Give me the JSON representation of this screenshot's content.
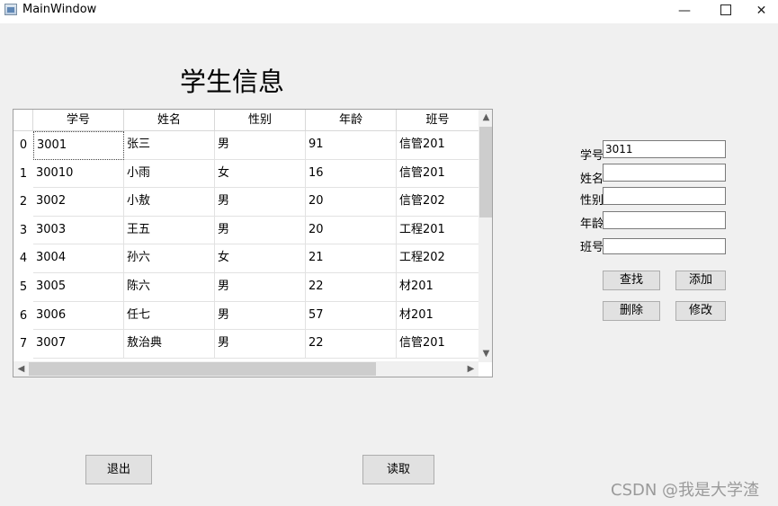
{
  "window": {
    "title": "MainWindow",
    "minimize_glyph": "—",
    "close_glyph": "✕"
  },
  "page_title": "学生信息",
  "table": {
    "columns": [
      "学号",
      "姓名",
      "性别",
      "年龄",
      "班号"
    ],
    "rows": [
      {
        "index": "0",
        "cells": [
          "3001",
          "张三",
          "男",
          "91",
          "信管201"
        ]
      },
      {
        "index": "1",
        "cells": [
          "30010",
          "小雨",
          "女",
          "16",
          "信管201"
        ]
      },
      {
        "index": "2",
        "cells": [
          "3002",
          "小敖",
          "男",
          "20",
          "信管202"
        ]
      },
      {
        "index": "3",
        "cells": [
          "3003",
          "王五",
          "男",
          "20",
          "工程201"
        ]
      },
      {
        "index": "4",
        "cells": [
          "3004",
          "孙六",
          "女",
          "21",
          "工程202"
        ]
      },
      {
        "index": "5",
        "cells": [
          "3005",
          "陈六",
          "男",
          "22",
          "材201"
        ]
      },
      {
        "index": "6",
        "cells": [
          "3006",
          "任七",
          "男",
          "57",
          "材201"
        ]
      },
      {
        "index": "7",
        "cells": [
          "3007",
          "敖治典",
          "男",
          "22",
          "信管201"
        ]
      }
    ]
  },
  "form": {
    "fields": [
      {
        "label": "学号",
        "value": "3011"
      },
      {
        "label": "姓名",
        "value": ""
      },
      {
        "label": "性别",
        "value": ""
      },
      {
        "label": "年龄",
        "value": ""
      },
      {
        "label": "班号",
        "value": ""
      }
    ]
  },
  "buttons": {
    "search": "查找",
    "add": "添加",
    "delete": "删除",
    "modify": "修改",
    "exit": "退出",
    "read": "读取"
  },
  "watermark": "CSDN @我是大学渣"
}
